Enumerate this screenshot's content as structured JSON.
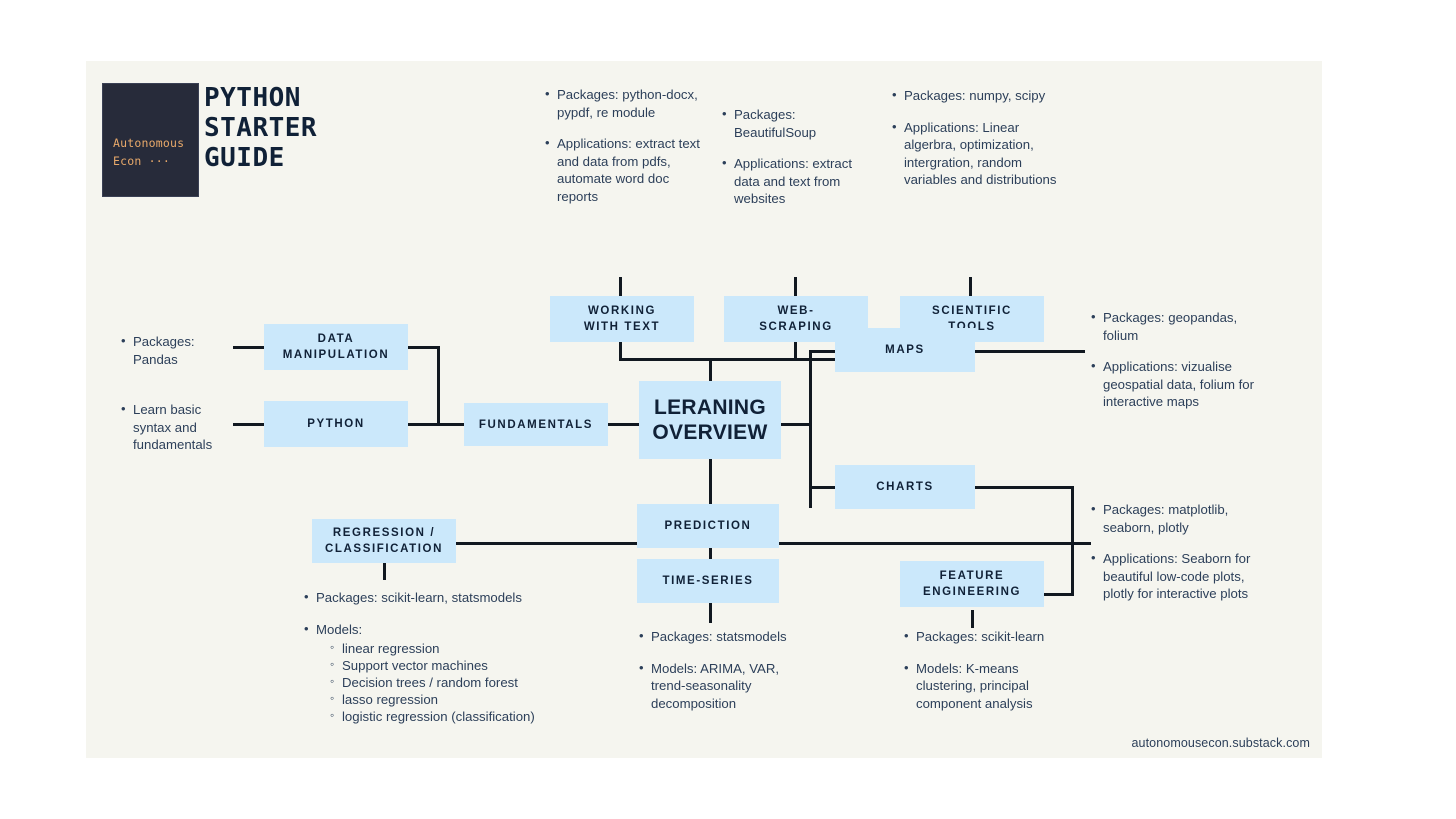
{
  "brand": {
    "logo_line1": "Autonomous",
    "logo_line2": "Econ ···",
    "logo_bg": "#272b3a",
    "logo_text_color": "#e8a96a"
  },
  "title": {
    "line1": "PYTHON",
    "line2": "STARTER",
    "line3": "GUIDE"
  },
  "theme": {
    "canvas_bg": "#f5f5ef",
    "node_fill": "#cbe8fb",
    "node_text": "#102137",
    "line_color": "#111820",
    "note_text": "#2c3f59"
  },
  "nodes": {
    "working_with_text": "WORKING\nWITH TEXT",
    "web_scraping": "WEB-\nSCRAPING",
    "scientific_tools": "SCIENTIFIC\nTOOLS",
    "data_manipulation": "DATA\nMANIPULATION",
    "python": "PYTHON",
    "fundamentals": "FUNDAMENTALS",
    "learning_overview": "LERANING\nOVERVIEW",
    "maps": "MAPS",
    "charts": "CHARTS",
    "regression_classification": "REGRESSION /\nCLASSIFICATION",
    "prediction": "PREDICTION",
    "time_series": "TIME-SERIES",
    "feature_engineering": "FEATURE\nENGINEERING"
  },
  "notes": {
    "working_with_text": [
      "Packages: python-docx, pypdf, re module",
      "Applications: extract text and data from pdfs, automate word doc reports"
    ],
    "web_scraping": [
      "Packages: BeautifulSoup",
      "Applications: extract data and text from websites"
    ],
    "scientific_tools": [
      "Packages: numpy, scipy",
      "Applications: Linear algerbra, optimization, intergration, random variables and distributions"
    ],
    "data_manipulation": [
      "Packages: Pandas"
    ],
    "python": [
      "Learn basic syntax and fundamentals"
    ],
    "maps": [
      "Packages: geopandas, folium",
      "Applications: vizualise geospatial data, folium for interactive maps"
    ],
    "charts": [
      "Packages: matplotlib, seaborn, plotly",
      "Applications: Seaborn for beautiful low-code plots, plotly for interactive plots"
    ],
    "regression_classification": {
      "packages": "Packages: scikit-learn, statsmodels",
      "models_label": "Models:",
      "models": [
        "linear regression",
        "Support vector machines",
        "Decision trees / random forest",
        "lasso regression",
        "logistic regression (classification)"
      ]
    },
    "time_series": [
      "Packages: statsmodels",
      "Models: ARIMA, VAR, trend-seasonality decomposition"
    ],
    "feature_engineering": [
      "Packages: scikit-learn",
      "Models: K-means clustering, principal component analysis"
    ]
  },
  "footer": {
    "url": "autonomousecon.substack.com"
  }
}
